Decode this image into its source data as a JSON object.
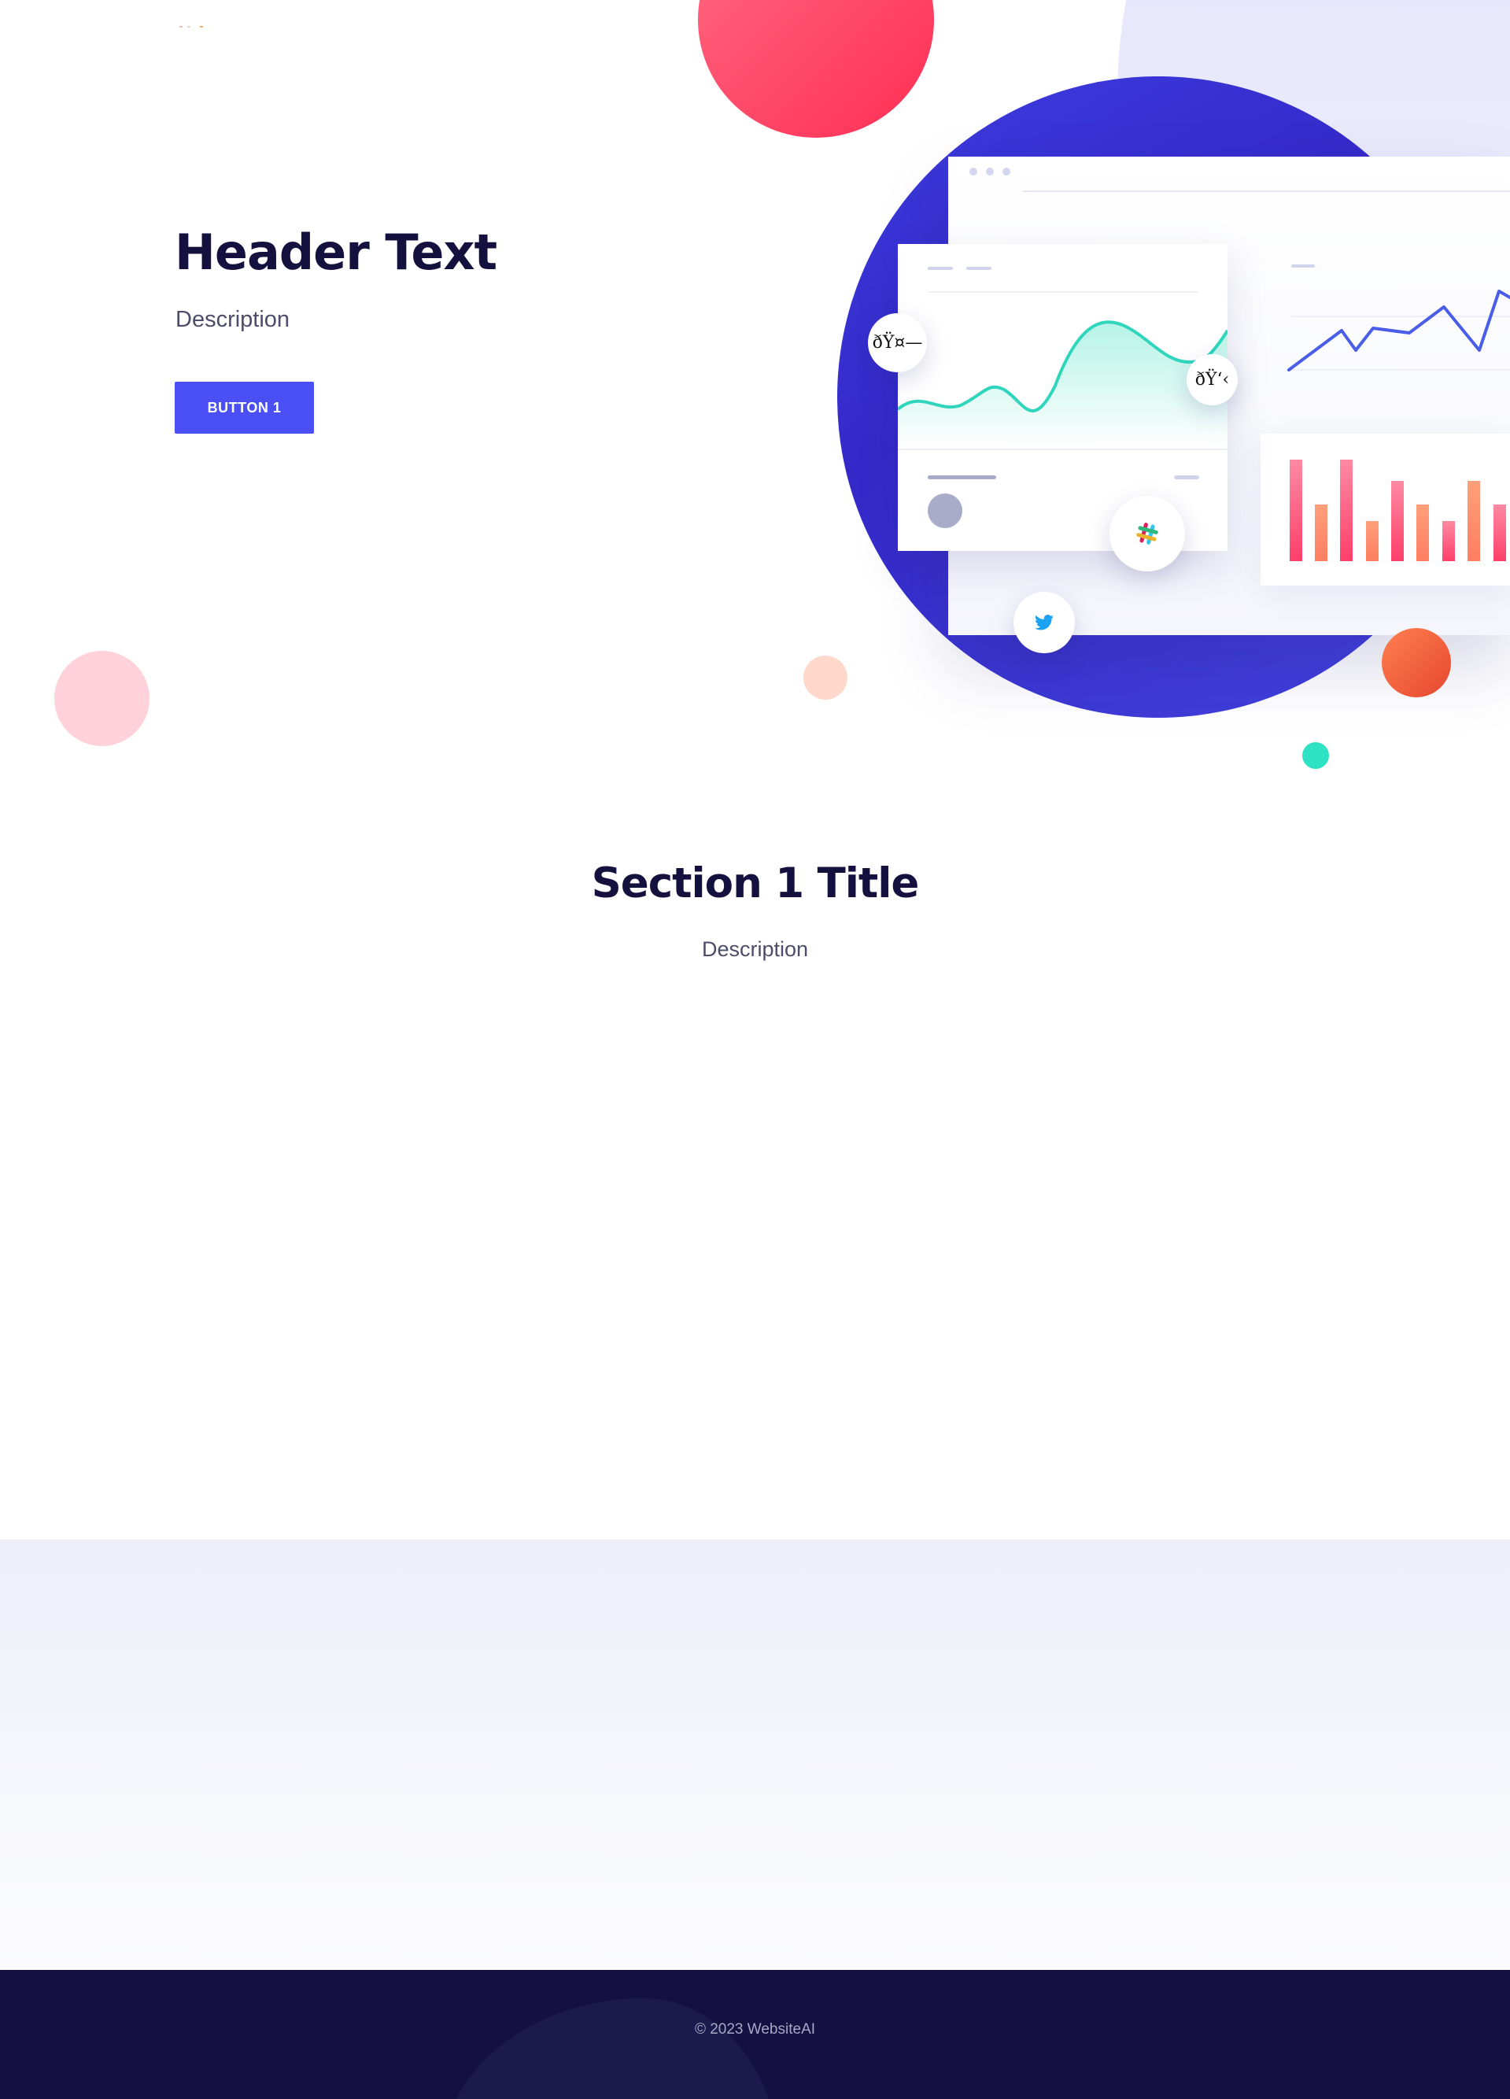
{
  "hero": {
    "title": "Header Text",
    "description": "Description",
    "button_label": "BUTTON 1"
  },
  "illustration": {
    "bubble_a_text": "ðŸ¤—",
    "bubble_b_text": "ðŸ‘‹",
    "icons": [
      "slack-icon",
      "twitter-icon"
    ]
  },
  "section1": {
    "title": "Section 1 Title",
    "description": "Description"
  },
  "footer": {
    "copyright": "© 2023 WebsiteAI"
  },
  "colors": {
    "primary": "#4a50f6",
    "heading": "#14113f",
    "footer_bg": "#141142",
    "accent_teal": "#2ee3c3",
    "accent_red": "#ff3d5f"
  }
}
